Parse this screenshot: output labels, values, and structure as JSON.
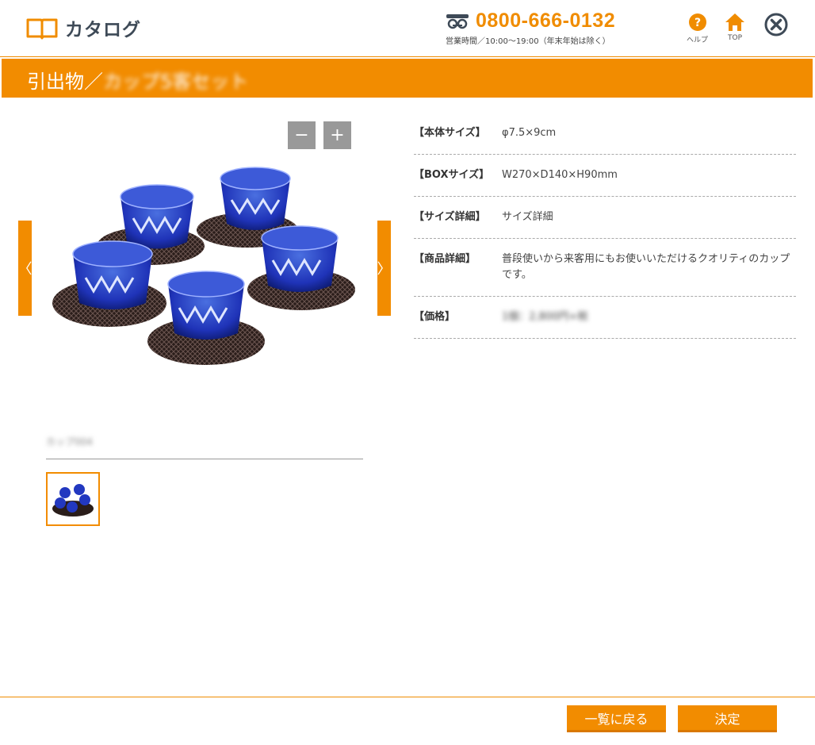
{
  "header": {
    "app_title": "カタログ",
    "phone_number": "0800-666-0132",
    "phone_hours": "営業時間／10:00～19:00（年末年始は除く）",
    "help_label": "ヘルプ",
    "top_label": "TOP"
  },
  "title_band": {
    "category": "引出物／",
    "product_name": "カップ5客セット"
  },
  "gallery": {
    "zoom_out_label": "−",
    "zoom_in_label": "+",
    "prev_label": "〈",
    "next_label": "〉",
    "product_code": "カップ004"
  },
  "specs": [
    {
      "label": "【本体サイズ】",
      "value": "φ7.5×9cm"
    },
    {
      "label": "【BOXサイズ】",
      "value": "W270×D140×H90mm"
    },
    {
      "label": "【サイズ詳細】",
      "value": "サイズ詳細"
    },
    {
      "label": "【商品詳細】",
      "value": "普段使いから来客用にもお使いいただけるクオリティのカップです。"
    },
    {
      "label": "【価格】",
      "value": "1個：2,800円+税"
    }
  ],
  "footer": {
    "back_label": "一覧に戻る",
    "ok_label": "決定"
  },
  "colors": {
    "accent": "#f28c00",
    "text_dark": "#3e4a57",
    "zoom_button": "#999999"
  },
  "icons": {
    "logo": "open-book-icon",
    "phone": "free-dial-icon",
    "help": "question-circle-icon",
    "top": "home-icon",
    "close": "close-circle-icon"
  }
}
